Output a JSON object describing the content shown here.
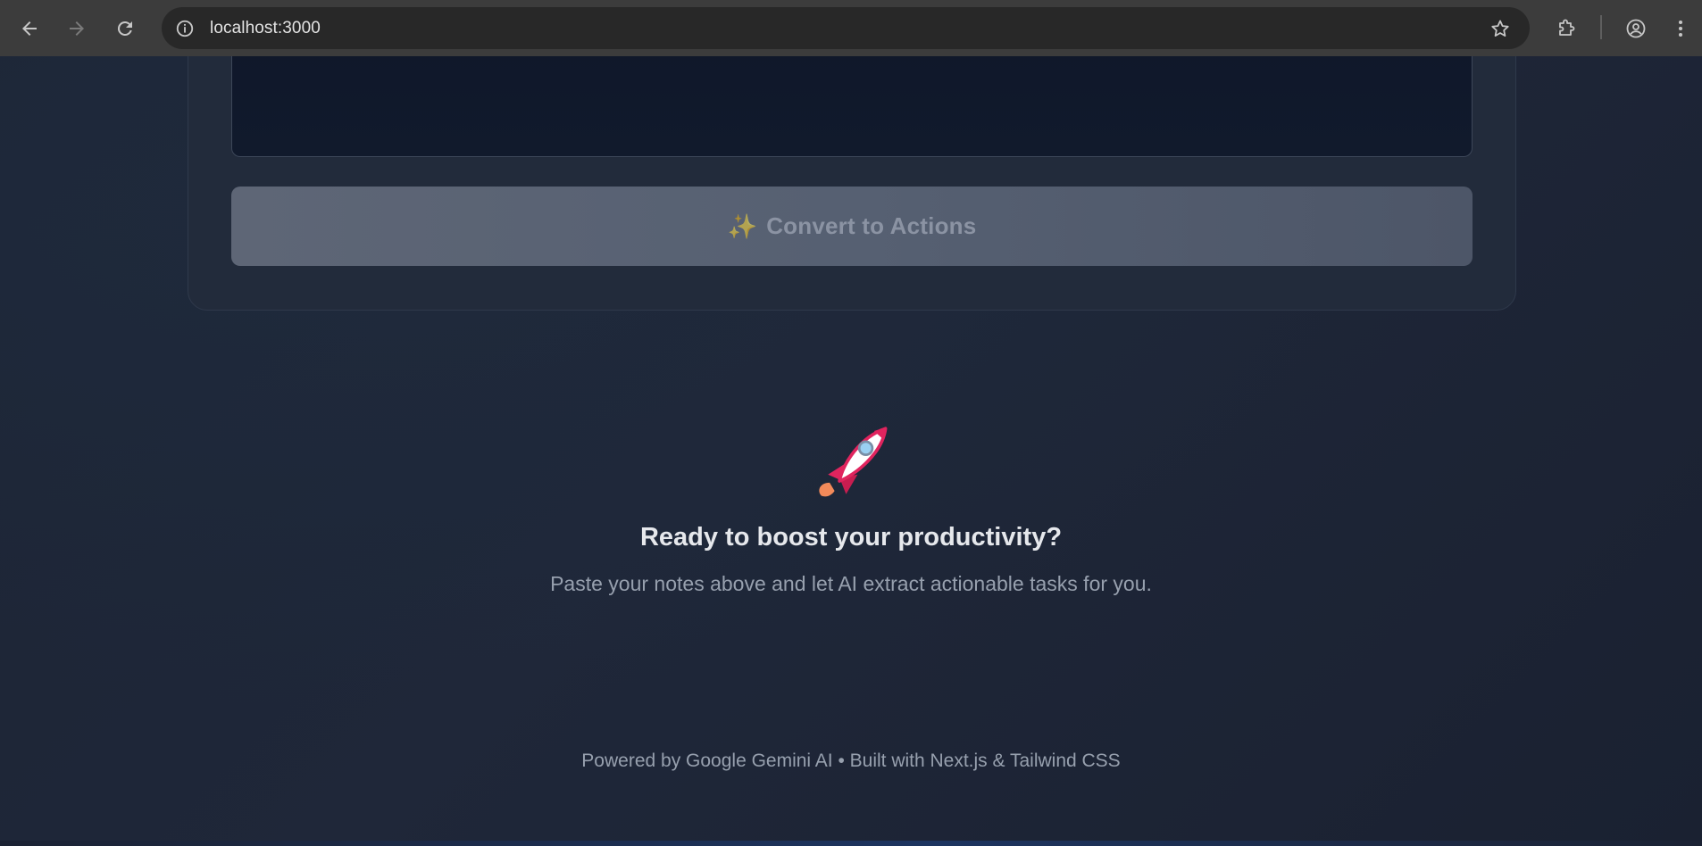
{
  "browser": {
    "url": "localhost:3000",
    "icons": {
      "back": "arrow-left-icon",
      "forward": "arrow-right-icon",
      "reload": "reload-icon",
      "site_info": "info-icon",
      "bookmark": "star-icon",
      "extensions": "puzzle-icon",
      "profile": "account-circle-icon",
      "menu": "more-vert-icon"
    }
  },
  "card": {
    "convert_button": {
      "icon": "✨",
      "label": "Convert to Actions",
      "disabled": true
    }
  },
  "empty_state": {
    "icon": "rocket-icon",
    "title": "Ready to boost your productivity?",
    "subtitle": "Paste your notes above and let AI extract actionable tasks for you."
  },
  "footer": {
    "text": "Powered by Google Gemini AI • Built with Next.js & Tailwind CSS"
  },
  "colors": {
    "background": "#1e2535",
    "card": "#222b3b",
    "button_disabled": "#566072",
    "title_text": "#e6e8ec",
    "muted_text": "#97a0ae"
  }
}
